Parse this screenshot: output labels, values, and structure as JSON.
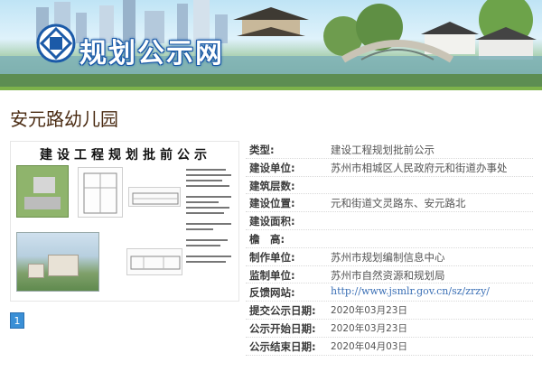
{
  "banner": {
    "site_title": "规划公示网"
  },
  "page": {
    "title": "安元路幼儿园"
  },
  "thumbnail": {
    "heading": "建设工程规划批前公示"
  },
  "pagination": {
    "current": "1"
  },
  "info": {
    "rows": [
      {
        "label": "类型:",
        "value": "建设工程规划批前公示"
      },
      {
        "label": "建设单位:",
        "value": "苏州市相城区人民政府元和街道办事处"
      },
      {
        "label": "建筑层数:",
        "value": ""
      },
      {
        "label": "建设位置:",
        "value": "元和街道文灵路东、安元路北"
      },
      {
        "label": "建设面积:",
        "value": ""
      },
      {
        "label": "檐　高:",
        "value": ""
      },
      {
        "label": "制作单位:",
        "value": "苏州市规划编制信息中心"
      },
      {
        "label": "监制单位:",
        "value": "苏州市自然资源和规划局"
      },
      {
        "label": "反馈网站:",
        "value": "http://www.jsmlr.gov.cn/sz/zrzy/"
      },
      {
        "label": "提交公示日期:",
        "value": "2020年03月23日"
      },
      {
        "label": "公示开始日期:",
        "value": "2020年03月23日"
      },
      {
        "label": "公示结束日期:",
        "value": "2020年04月03日"
      }
    ]
  },
  "colors": {
    "accent_green": "#7db24a",
    "title_brown": "#4a2b12",
    "link_blue": "#3a6fb5",
    "pager_blue": "#3a8fd6"
  },
  "icons": {
    "logo": "site-logo-icon"
  }
}
